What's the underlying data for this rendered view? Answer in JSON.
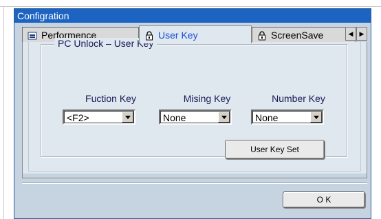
{
  "window": {
    "title": "Configration"
  },
  "tabs": [
    {
      "label": "Performence",
      "icon": "performance-icon"
    },
    {
      "label": "User Key",
      "icon": "user-key-icon",
      "active": true
    },
    {
      "label": "ScreenSave",
      "icon": "screensaver-icon"
    }
  ],
  "tab_scroll": {
    "left_icon": "scroll-left-icon",
    "right_icon": "scroll-right-icon"
  },
  "group": {
    "title": "PC Unlock – User Key"
  },
  "fields": {
    "function_key": {
      "label": "Fuction Key",
      "value": "<F2>"
    },
    "mising_key": {
      "label": "Mising Key",
      "value": "None"
    },
    "number_key": {
      "label": "Number Key",
      "value": "None"
    }
  },
  "buttons": {
    "user_key_set": "User Key Set",
    "ok": "O K"
  },
  "colors": {
    "titlebar": "#1d64c2",
    "active_tab_text": "#1b4fd6",
    "panel": "#dfe7ef",
    "frame": "#c6d3e0"
  }
}
